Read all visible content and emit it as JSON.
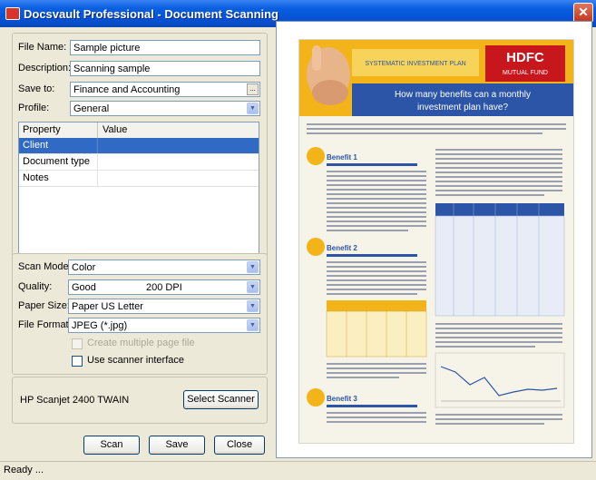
{
  "window": {
    "title": "Docsvault Professional - Document Scanning",
    "close_glyph": "✕"
  },
  "form": {
    "file_name_label": "File Name:",
    "file_name_value": "Sample picture",
    "description_label": "Description:",
    "description_value": "Scanning sample",
    "save_to_label": "Save to:",
    "save_to_value": "Finance and Accounting",
    "save_to_browse": "...",
    "profile_label": "Profile:",
    "profile_value": "General"
  },
  "properties": {
    "col_property": "Property",
    "col_value": "Value",
    "rows": [
      {
        "property": "Client",
        "value": ""
      },
      {
        "property": "Document type",
        "value": ""
      },
      {
        "property": "Notes",
        "value": ""
      }
    ]
  },
  "scan": {
    "mode_label": "Scan Mode:",
    "mode_value": "Color",
    "quality_label": "Quality:",
    "quality_value": "Good",
    "quality_dpi": "200 DPI",
    "paper_label": "Paper Size:",
    "paper_value": "Paper US Letter",
    "format_label": "File Format:",
    "format_value": "JPEG (*.jpg)",
    "multi_page_label": "Create multiple page file",
    "scanner_interface_label": "Use scanner interface"
  },
  "scanner": {
    "name": "HP Scanjet 2400 TWAIN",
    "select_button": "Select Scanner"
  },
  "buttons": {
    "scan": "Scan",
    "save": "Save",
    "close": "Close"
  },
  "status": {
    "text": "Ready ..."
  },
  "preview": {
    "banner_text": "SYSTEMATIC INVESTMENT PLAN",
    "brand": "HDFC",
    "brand_sub": "MUTUAL FUND",
    "headline_1": "How many benefits can a monthly",
    "headline_2": "investment plan have?",
    "benefit_1": "Benefit 1",
    "benefit_2": "Benefit 2",
    "benefit_3": "Benefit 3"
  },
  "colors": {
    "title_bar": "#0452d6",
    "selection": "#316ac5",
    "doc_header": "#f2b418",
    "doc_banner": "#2c55a8",
    "brand_red": "#c8161d"
  }
}
